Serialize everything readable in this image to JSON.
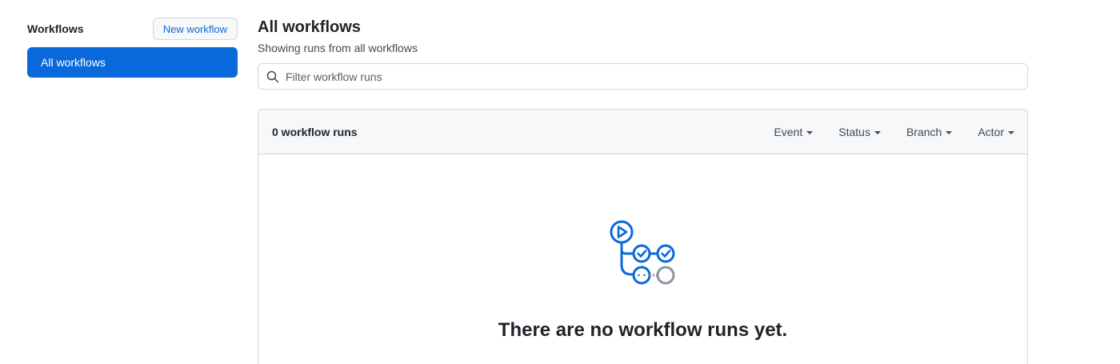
{
  "sidebar": {
    "title": "Workflows",
    "new_button_label": "New workflow",
    "items": [
      {
        "label": "All workflows",
        "selected": true
      }
    ]
  },
  "main": {
    "title": "All workflows",
    "subtitle": "Showing runs from all workflows",
    "filter": {
      "placeholder": "Filter workflow runs",
      "icon": "search-icon"
    },
    "runs": {
      "count_label": "0 workflow runs",
      "menus": [
        "Event",
        "Status",
        "Branch",
        "Actor"
      ]
    },
    "empty_state": {
      "title": "There are no workflow runs yet.",
      "icon": "workflow-icon"
    }
  },
  "colors": {
    "accent": "#0969da",
    "border": "#d0d7de",
    "header_bg": "#f6f8fa",
    "text": "#1f2328",
    "muted": "#424a53"
  }
}
